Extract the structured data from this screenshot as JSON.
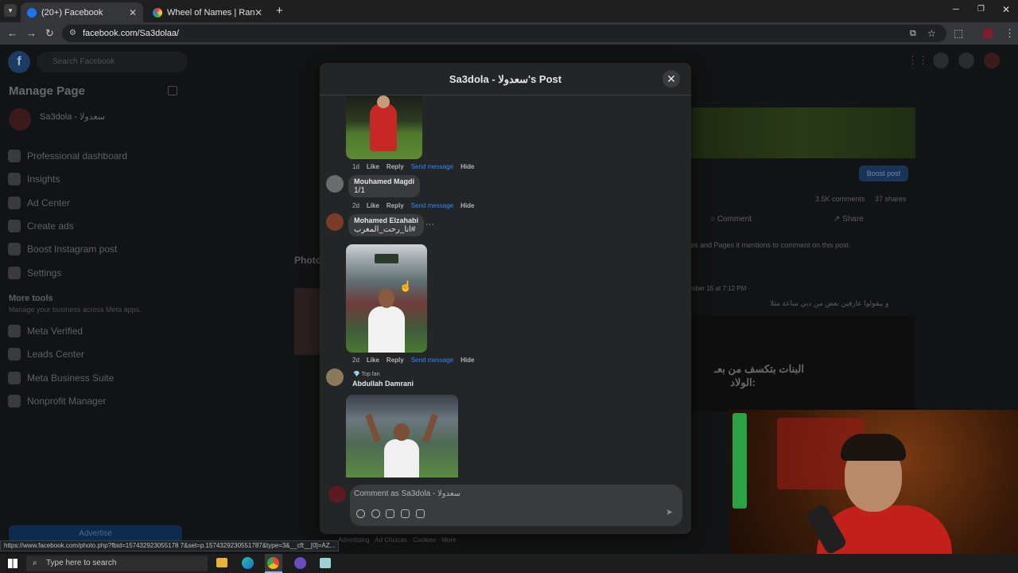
{
  "browser": {
    "tabs": [
      {
        "label": "(20+) Facebook",
        "active": true
      },
      {
        "label": "Wheel of Names | Random nam",
        "active": false
      }
    ],
    "new_tab": "+",
    "url": "facebook.com/Sa3dolaa/",
    "status_url": "https://www.facebook.com/photo.php?fbid=157432923055178 7&set=p.1574329230551787&type=3&__cft__[0]=AZ..."
  },
  "sidebar": {
    "search_placeholder": "Search Facebook",
    "title": "Manage Page",
    "page_name": "Sa3dola - سعدولا",
    "items": [
      {
        "label": "Professional dashboard"
      },
      {
        "label": "Insights"
      },
      {
        "label": "Ad Center"
      },
      {
        "label": "Create ads"
      },
      {
        "label": "Boost Instagram post"
      },
      {
        "label": "Settings"
      }
    ],
    "more_tools_title": "More tools",
    "more_tools_sub": "Manage your business across Meta apps.",
    "more_items": [
      {
        "label": "Meta Verified"
      },
      {
        "label": "Leads Center"
      },
      {
        "label": "Meta Business Suite"
      },
      {
        "label": "Nonprofit Manager"
      }
    ],
    "advertise": "Advertise"
  },
  "background": {
    "boost_post": "Boost post",
    "comments_count": "3.5K comments",
    "shares_count": "37 shares",
    "comment_btn": "Comment",
    "share_btn": "Share",
    "photos_label": "Photo",
    "mentions_note": "es and Pages it mentions to comment on this post.",
    "post_date": "mber 15 at 7:12 PM ·",
    "post_text": "و بيقولوا عارفين بعض من دبي ساعة مثلا",
    "overlay_line1": "البنات بتكسف من بعـ",
    "overlay_line2": "الولاد:",
    "footer_links": "Advertising · Ad Choices · Cookies · More"
  },
  "modal": {
    "title": "Sa3dola - سعدولا's Post",
    "comments": [
      {
        "time": "1d",
        "actions": [
          "Like",
          "Reply"
        ],
        "send": "Send message",
        "hide": "Hide"
      },
      {
        "name": "Mouhamed Magdi",
        "text": "1/1",
        "time": "2d",
        "actions": [
          "Like",
          "Reply"
        ],
        "send": "Send message",
        "hide": "Hide"
      },
      {
        "name": "Mohamed Elzahabi",
        "text": "#انا_رحت_المغرب",
        "time": "2d",
        "actions": [
          "Like",
          "Reply"
        ],
        "send": "Send message",
        "hide": "Hide"
      },
      {
        "badge": "Top fan",
        "name": "Abdullah Damrani"
      }
    ],
    "composer_placeholder": "Comment as Sa3dola - سعدولا"
  },
  "taskbar": {
    "search_placeholder": "Type here to search"
  },
  "colors": {
    "accent": "#2d88ff",
    "modal_bg": "#242526",
    "bubble_bg": "#3a3b3c"
  }
}
